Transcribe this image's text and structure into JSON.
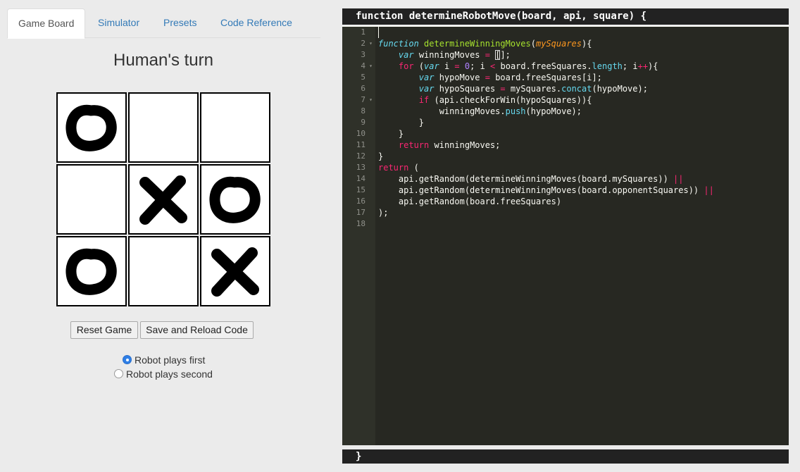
{
  "tabs": [
    {
      "label": "Game Board",
      "active": true
    },
    {
      "label": "Simulator",
      "active": false
    },
    {
      "label": "Presets",
      "active": false
    },
    {
      "label": "Code Reference",
      "active": false
    }
  ],
  "game": {
    "status": "Human's turn",
    "board": [
      "O",
      "",
      "",
      "",
      "X",
      "O",
      "O",
      "",
      "X"
    ],
    "reset_label": "Reset Game",
    "save_label": "Save and Reload Code",
    "radio_options": [
      {
        "label": "Robot plays first",
        "checked": true
      },
      {
        "label": "Robot plays second",
        "checked": false
      }
    ]
  },
  "editor": {
    "header": "function determineRobotMove(board, api, square) {",
    "footer": "}",
    "line_count": 18,
    "fold_lines": [
      2,
      4,
      7
    ],
    "lines": [
      [],
      [
        [
          "kw-italic",
          "function"
        ],
        [
          "txt",
          " "
        ],
        [
          "fn",
          "determineWinningMoves"
        ],
        [
          "txt",
          "("
        ],
        [
          "param",
          "mySquares"
        ],
        [
          "txt",
          "){"
        ]
      ],
      [
        [
          "txt",
          "    "
        ],
        [
          "kw-italic",
          "var"
        ],
        [
          "txt",
          " winningMoves "
        ],
        [
          "op",
          "="
        ],
        [
          "txt",
          " "
        ],
        [
          "bracket",
          "["
        ],
        [
          "txt",
          "];"
        ]
      ],
      [
        [
          "txt",
          "    "
        ],
        [
          "kw",
          "for"
        ],
        [
          "txt",
          " ("
        ],
        [
          "kw-italic",
          "var"
        ],
        [
          "txt",
          " i "
        ],
        [
          "op",
          "="
        ],
        [
          "txt",
          " "
        ],
        [
          "num",
          "0"
        ],
        [
          "txt",
          "; i "
        ],
        [
          "op",
          "<"
        ],
        [
          "txt",
          " board.freeSquares."
        ],
        [
          "prop",
          "length"
        ],
        [
          "txt",
          "; i"
        ],
        [
          "op",
          "++"
        ],
        [
          "txt",
          "){"
        ]
      ],
      [
        [
          "txt",
          "        "
        ],
        [
          "kw-italic",
          "var"
        ],
        [
          "txt",
          " hypoMove "
        ],
        [
          "op",
          "="
        ],
        [
          "txt",
          " board.freeSquares[i];"
        ]
      ],
      [
        [
          "txt",
          "        "
        ],
        [
          "kw-italic",
          "var"
        ],
        [
          "txt",
          " hypoSquares "
        ],
        [
          "op",
          "="
        ],
        [
          "txt",
          " mySquares."
        ],
        [
          "prop",
          "concat"
        ],
        [
          "txt",
          "(hypoMove);"
        ]
      ],
      [
        [
          "txt",
          "        "
        ],
        [
          "kw",
          "if"
        ],
        [
          "txt",
          " (api.checkForWin(hypoSquares)){"
        ]
      ],
      [
        [
          "txt",
          "            winningMoves."
        ],
        [
          "prop",
          "push"
        ],
        [
          "txt",
          "(hypoMove);"
        ]
      ],
      [
        [
          "txt",
          "        }"
        ]
      ],
      [
        [
          "txt",
          "    }"
        ]
      ],
      [
        [
          "txt",
          "    "
        ],
        [
          "kw",
          "return"
        ],
        [
          "txt",
          " winningMoves;"
        ]
      ],
      [
        [
          "txt",
          "}"
        ]
      ],
      [
        [
          "kw",
          "return"
        ],
        [
          "txt",
          " ("
        ]
      ],
      [
        [
          "txt",
          "    api.getRandom(determineWinningMoves(board.mySquares)) "
        ],
        [
          "op",
          "||"
        ]
      ],
      [
        [
          "txt",
          "    api.getRandom(determineWinningMoves(board.opponentSquares)) "
        ],
        [
          "op",
          "||"
        ]
      ],
      [
        [
          "txt",
          "    api.getRandom(board.freeSquares)"
        ]
      ],
      [
        [
          "txt",
          ");"
        ]
      ],
      []
    ]
  },
  "colors": {
    "editor_bg": "#272822",
    "gutter_bg": "#2f3129",
    "keyword": "#f92672",
    "function": "#a6e22e",
    "param": "#fd971f",
    "number": "#ae81ff",
    "property": "#66d9ef",
    "radio_checked": "#2f7fe6",
    "tab_link": "#337ab7"
  }
}
